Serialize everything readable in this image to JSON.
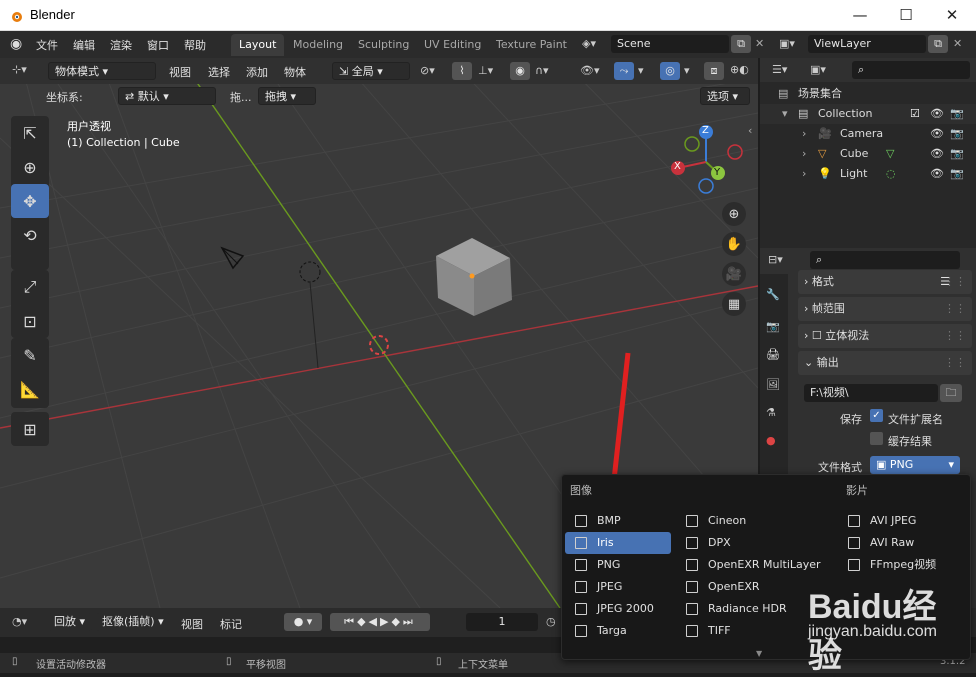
{
  "window": {
    "title": "Blender"
  },
  "menu": [
    "文件",
    "编辑",
    "渲染",
    "窗口",
    "帮助"
  ],
  "workspaces": [
    "Layout",
    "Modeling",
    "Sculpting",
    "UV Editing",
    "Texture Paint"
  ],
  "scene": {
    "name": "Scene",
    "view_layer": "ViewLayer"
  },
  "viewport_header": {
    "mode": "物体模式",
    "items": [
      "视图",
      "选择",
      "添加",
      "物体"
    ],
    "transform_orient": "全局"
  },
  "viewport_header2": {
    "coord_label": "坐标系:",
    "coord_value": "默认",
    "drag_label": "拖...",
    "drag_value": "拖拽",
    "options": "选项"
  },
  "viewport_info": {
    "view": "用户透视",
    "collection": "(1) Collection | Cube"
  },
  "gizmo": {
    "x": "X",
    "y": "Y",
    "z": "Z"
  },
  "outliner": {
    "root": "场景集合",
    "collection": "Collection",
    "items": [
      "Camera",
      "Cube",
      "Light"
    ]
  },
  "properties": {
    "panels": [
      "格式",
      "帧范围",
      "立体视法",
      "输出"
    ],
    "output_path": "F:\\视频\\",
    "save_label": "保存",
    "file_ext_label": "文件扩展名",
    "cache_label": "缓存结果",
    "format_label": "文件格式",
    "format_value": "PNG"
  },
  "timeline": {
    "items": [
      "回放",
      "抠像(插帧)",
      "视图",
      "标记"
    ],
    "frame": "1"
  },
  "status": {
    "left": "设置活动修改器",
    "mid": "平移视图",
    "right": "上下文菜单",
    "version": "3.1.2"
  },
  "popup": {
    "image_header": "图像",
    "movie_header": "影片",
    "col1": [
      "BMP",
      "Iris",
      "PNG",
      "JPEG",
      "JPEG 2000",
      "Targa"
    ],
    "col2": [
      "Cineon",
      "DPX",
      "OpenEXR MultiLayer",
      "OpenEXR",
      "Radiance HDR",
      "TIFF"
    ],
    "col3": [
      "AVI JPEG",
      "AVI Raw",
      "FFmpeg视频"
    ],
    "selected": "Iris"
  },
  "watermark": {
    "brand": "Baidu经验",
    "url": "jingyan.baidu.com"
  },
  "colors": {
    "accent": "#4772b3",
    "x_axis": "#c8323c",
    "y_axis": "#6a9a1e",
    "arrow": "#e02020"
  }
}
